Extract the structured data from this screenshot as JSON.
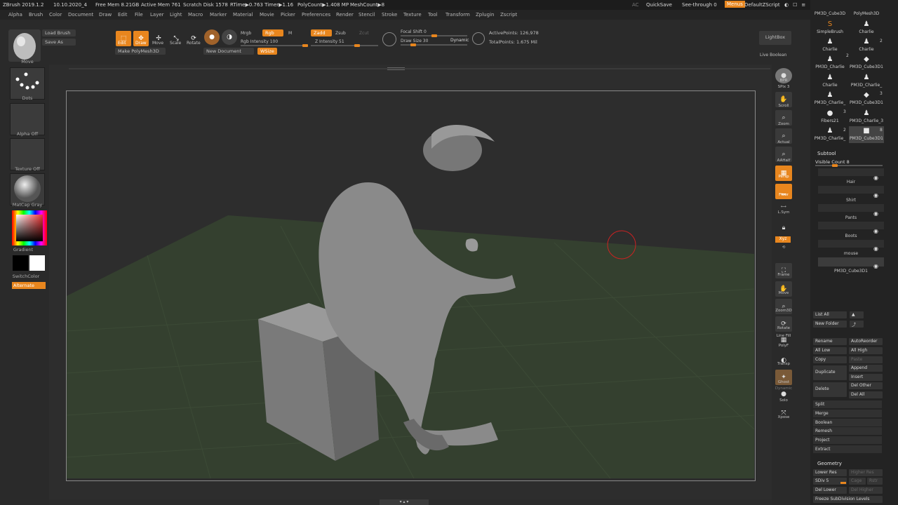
{
  "titlebar": {
    "app": "ZBrush 2019.1.2",
    "date": "10.10.2020_4",
    "free_mem": "Free Mem 8.21GB",
    "active_mem": "Active Mem 761",
    "scratch_disk": "Scratch Disk 1578",
    "rtime": "RTime▶0.763 Timer▶1.16",
    "polycount": "PolyCount▶1.408 MP",
    "meshcount": "MeshCount▶8",
    "ac": "AC",
    "quicksave": "QuickSave",
    "see_through": "See-through  0",
    "menus": "Menus",
    "script": "DefaultZScript"
  },
  "menubar": [
    "Alpha",
    "Brush",
    "Color",
    "Document",
    "Draw",
    "Edit",
    "File",
    "Layer",
    "Light",
    "Macro",
    "Marker",
    "Material",
    "Movie",
    "Picker",
    "Preferences",
    "Render",
    "Stencil",
    "Stroke",
    "Texture",
    "Tool",
    "Transform",
    "Zplugin",
    "Zscript"
  ],
  "toolbar": {
    "load_brush": "Load Brush",
    "save_as": "Save As",
    "edit": "Edit",
    "draw": "Draw",
    "move": "Move",
    "scale": "Scale",
    "rotate": "Rotate",
    "make_polymesh": "Make PolyMesh3D",
    "new_document": "New Document",
    "wsize": "WSize",
    "mrgb": "Mrgb",
    "rgb": "Rgb",
    "m": "M",
    "rgb_intensity": "Rgb Intensity 100",
    "zadd": "Zadd",
    "zsub": "Zsub",
    "zcut": "Zcut",
    "z_intensity": "Z Intensity 51",
    "focal_shift": "Focal Shift 0",
    "draw_size": "Draw Size 30",
    "dynamic": "Dynamic",
    "active_points": "ActivePoints: 126,978",
    "total_points": "TotalPoints: 1.675 Mil",
    "lightbox": "LightBox",
    "live_boolean": "Live Boolean"
  },
  "leftshelf": {
    "brush": "Move",
    "stroke": "Dots",
    "alpha": "Alpha Off",
    "texture": "Texture Off",
    "material": "MatCap Gray",
    "gradient": "Gradient",
    "switchcolor": "SwitchColor",
    "alternate": "Alternate"
  },
  "rightshelf": [
    "BPR",
    "SPix 3",
    "Scroll",
    "Zoom",
    "Actual",
    "AAHalf",
    "Persp",
    "Floor",
    "L.Sym",
    "",
    "Xyz",
    "",
    "Frame",
    "Move",
    "Zoom3D",
    "Rotate",
    "Line Fill",
    "PolyF",
    "Transp",
    "Ghost",
    "Dynamic",
    "Solo",
    "Xpose"
  ],
  "tray": {
    "tools": [
      {
        "name": "PM3D_Cube3D",
        "num": ""
      },
      {
        "name": "PolyMesh3D",
        "num": ""
      },
      {
        "name": "SimpleBrush",
        "num": ""
      },
      {
        "name": "Charlie",
        "num": ""
      },
      {
        "name": "Charlie",
        "num": ""
      },
      {
        "name": "Charlie",
        "num": "2"
      },
      {
        "name": "PM3D_Charlie",
        "num": ""
      },
      {
        "name": "PM3D_Cube3D1",
        "num": "2"
      },
      {
        "name": "Charlie",
        "num": ""
      },
      {
        "name": "PM3D_Charlie_",
        "num": ""
      },
      {
        "name": "PM3D_Charlie_",
        "num": ""
      },
      {
        "name": "PM3D_Cube3D1",
        "num": "3"
      },
      {
        "name": "Fibers21",
        "num": "3"
      },
      {
        "name": "PM3D_Charlie_3",
        "num": ""
      },
      {
        "name": "PM3D_Charlie_",
        "num": "2"
      },
      {
        "name": "PM3D_Cube3D1",
        "num": "8"
      }
    ],
    "subtool_title": "Subtool",
    "visible_count": "Visible Count 8",
    "subtools": [
      "Hair",
      "Shirt",
      "Pants",
      "Boots",
      "mouse",
      "PM3D_Cube3D1"
    ],
    "buttons": {
      "list_all": "List All",
      "new_folder": "New Folder",
      "rename": "Rename",
      "autoreorder": "AutoReorder",
      "all_low": "All Low",
      "all_high": "All High",
      "copy": "Copy",
      "paste": "Paste",
      "duplicate": "Duplicate",
      "append": "Append",
      "insert": "Insert",
      "delete": "Delete",
      "del_other": "Del Other",
      "del_all": "Del All",
      "split": "Split",
      "merge": "Merge",
      "boolean": "Boolean",
      "remesh": "Remesh",
      "project": "Project",
      "extract": "Extract"
    },
    "geometry": {
      "title": "Geometry",
      "lower_res": "Lower Res",
      "higher_res": "Higher Res",
      "sdiv": "SDiv 5",
      "cage": "Cage",
      "rstr": "Rstr",
      "del_lower": "Del Lower",
      "del_higher": "Del Higher",
      "freeze": "Freeze SubDivision Levels"
    }
  },
  "colors": {
    "accent": "#e8861e",
    "floor": "#34402f",
    "model": "#8a8a8a"
  }
}
